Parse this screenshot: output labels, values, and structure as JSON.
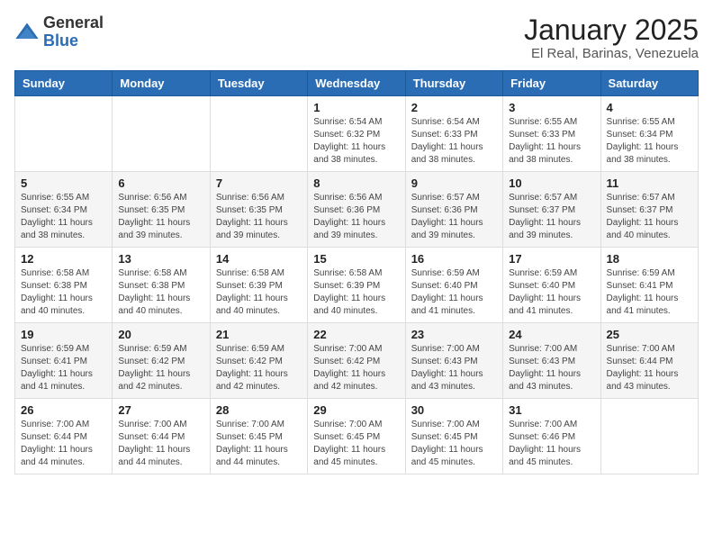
{
  "header": {
    "logo_general": "General",
    "logo_blue": "Blue",
    "title": "January 2025",
    "subtitle": "El Real, Barinas, Venezuela"
  },
  "calendar": {
    "days_of_week": [
      "Sunday",
      "Monday",
      "Tuesday",
      "Wednesday",
      "Thursday",
      "Friday",
      "Saturday"
    ],
    "weeks": [
      [
        {
          "day": "",
          "info": ""
        },
        {
          "day": "",
          "info": ""
        },
        {
          "day": "",
          "info": ""
        },
        {
          "day": "1",
          "info": "Sunrise: 6:54 AM\nSunset: 6:32 PM\nDaylight: 11 hours and 38 minutes."
        },
        {
          "day": "2",
          "info": "Sunrise: 6:54 AM\nSunset: 6:33 PM\nDaylight: 11 hours and 38 minutes."
        },
        {
          "day": "3",
          "info": "Sunrise: 6:55 AM\nSunset: 6:33 PM\nDaylight: 11 hours and 38 minutes."
        },
        {
          "day": "4",
          "info": "Sunrise: 6:55 AM\nSunset: 6:34 PM\nDaylight: 11 hours and 38 minutes."
        }
      ],
      [
        {
          "day": "5",
          "info": "Sunrise: 6:55 AM\nSunset: 6:34 PM\nDaylight: 11 hours and 38 minutes."
        },
        {
          "day": "6",
          "info": "Sunrise: 6:56 AM\nSunset: 6:35 PM\nDaylight: 11 hours and 39 minutes."
        },
        {
          "day": "7",
          "info": "Sunrise: 6:56 AM\nSunset: 6:35 PM\nDaylight: 11 hours and 39 minutes."
        },
        {
          "day": "8",
          "info": "Sunrise: 6:56 AM\nSunset: 6:36 PM\nDaylight: 11 hours and 39 minutes."
        },
        {
          "day": "9",
          "info": "Sunrise: 6:57 AM\nSunset: 6:36 PM\nDaylight: 11 hours and 39 minutes."
        },
        {
          "day": "10",
          "info": "Sunrise: 6:57 AM\nSunset: 6:37 PM\nDaylight: 11 hours and 39 minutes."
        },
        {
          "day": "11",
          "info": "Sunrise: 6:57 AM\nSunset: 6:37 PM\nDaylight: 11 hours and 40 minutes."
        }
      ],
      [
        {
          "day": "12",
          "info": "Sunrise: 6:58 AM\nSunset: 6:38 PM\nDaylight: 11 hours and 40 minutes."
        },
        {
          "day": "13",
          "info": "Sunrise: 6:58 AM\nSunset: 6:38 PM\nDaylight: 11 hours and 40 minutes."
        },
        {
          "day": "14",
          "info": "Sunrise: 6:58 AM\nSunset: 6:39 PM\nDaylight: 11 hours and 40 minutes."
        },
        {
          "day": "15",
          "info": "Sunrise: 6:58 AM\nSunset: 6:39 PM\nDaylight: 11 hours and 40 minutes."
        },
        {
          "day": "16",
          "info": "Sunrise: 6:59 AM\nSunset: 6:40 PM\nDaylight: 11 hours and 41 minutes."
        },
        {
          "day": "17",
          "info": "Sunrise: 6:59 AM\nSunset: 6:40 PM\nDaylight: 11 hours and 41 minutes."
        },
        {
          "day": "18",
          "info": "Sunrise: 6:59 AM\nSunset: 6:41 PM\nDaylight: 11 hours and 41 minutes."
        }
      ],
      [
        {
          "day": "19",
          "info": "Sunrise: 6:59 AM\nSunset: 6:41 PM\nDaylight: 11 hours and 41 minutes."
        },
        {
          "day": "20",
          "info": "Sunrise: 6:59 AM\nSunset: 6:42 PM\nDaylight: 11 hours and 42 minutes."
        },
        {
          "day": "21",
          "info": "Sunrise: 6:59 AM\nSunset: 6:42 PM\nDaylight: 11 hours and 42 minutes."
        },
        {
          "day": "22",
          "info": "Sunrise: 7:00 AM\nSunset: 6:42 PM\nDaylight: 11 hours and 42 minutes."
        },
        {
          "day": "23",
          "info": "Sunrise: 7:00 AM\nSunset: 6:43 PM\nDaylight: 11 hours and 43 minutes."
        },
        {
          "day": "24",
          "info": "Sunrise: 7:00 AM\nSunset: 6:43 PM\nDaylight: 11 hours and 43 minutes."
        },
        {
          "day": "25",
          "info": "Sunrise: 7:00 AM\nSunset: 6:44 PM\nDaylight: 11 hours and 43 minutes."
        }
      ],
      [
        {
          "day": "26",
          "info": "Sunrise: 7:00 AM\nSunset: 6:44 PM\nDaylight: 11 hours and 44 minutes."
        },
        {
          "day": "27",
          "info": "Sunrise: 7:00 AM\nSunset: 6:44 PM\nDaylight: 11 hours and 44 minutes."
        },
        {
          "day": "28",
          "info": "Sunrise: 7:00 AM\nSunset: 6:45 PM\nDaylight: 11 hours and 44 minutes."
        },
        {
          "day": "29",
          "info": "Sunrise: 7:00 AM\nSunset: 6:45 PM\nDaylight: 11 hours and 45 minutes."
        },
        {
          "day": "30",
          "info": "Sunrise: 7:00 AM\nSunset: 6:45 PM\nDaylight: 11 hours and 45 minutes."
        },
        {
          "day": "31",
          "info": "Sunrise: 7:00 AM\nSunset: 6:46 PM\nDaylight: 11 hours and 45 minutes."
        },
        {
          "day": "",
          "info": ""
        }
      ]
    ]
  }
}
